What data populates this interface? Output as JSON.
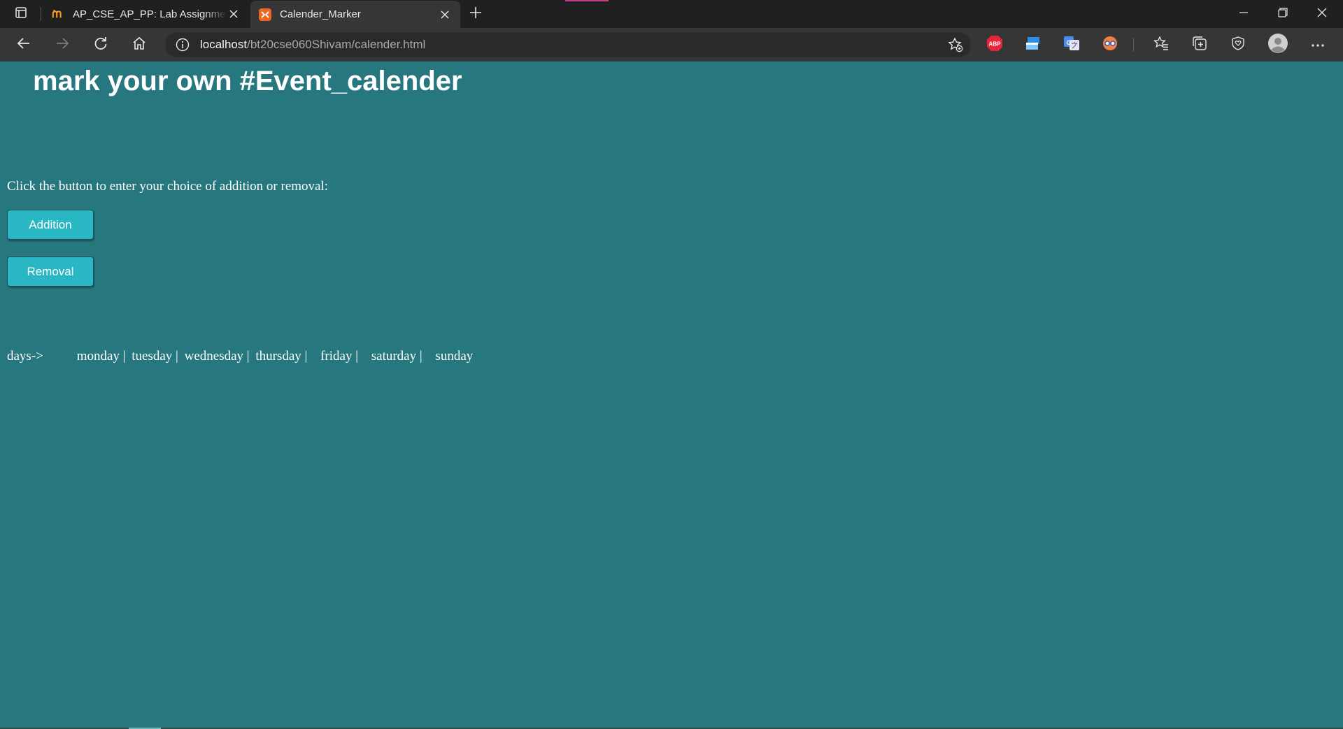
{
  "browser": {
    "tabs": [
      {
        "title": "AP_CSE_AP_PP: Lab Assignment",
        "favicon": "moodle-icon",
        "active": false
      },
      {
        "title": "Calender_Marker",
        "favicon": "xampp-icon",
        "active": true
      }
    ],
    "address": {
      "host": "localhost",
      "path": "/bt20cse060Shivam/calender.html"
    },
    "extensions": {
      "abp": "ABP"
    }
  },
  "page": {
    "heading": "mark your own #Event_calender",
    "instruction": "Click the button to enter your choice of addition or removal:",
    "buttons": {
      "addition": "Addition",
      "removal": "Removal"
    },
    "days_label": "days->",
    "days": [
      "monday |",
      "tuesday |",
      "wednesday |",
      "thursday |",
      "friday |",
      "saturday |",
      "sunday"
    ]
  },
  "colors": {
    "page_background": "#27777f",
    "button_background": "#2ab7c4",
    "chrome_dark": "#202020",
    "chrome_toolbar": "#363636"
  }
}
